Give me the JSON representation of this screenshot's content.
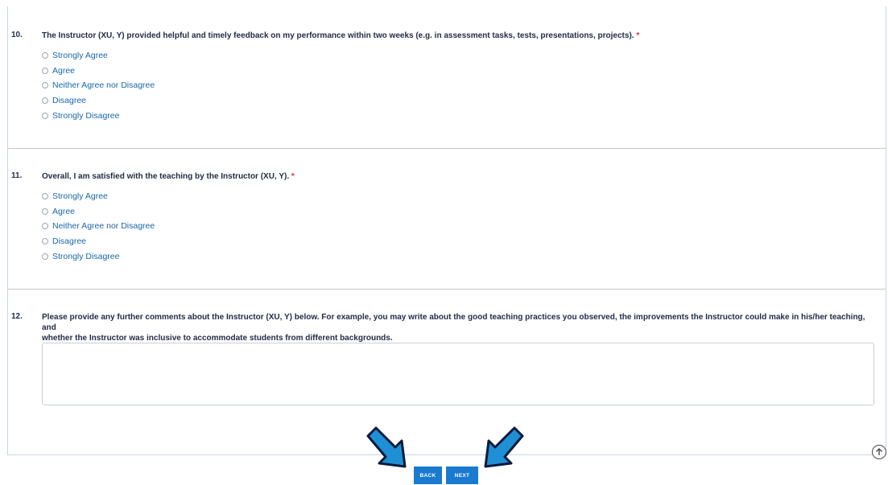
{
  "questions": [
    {
      "number": "10.",
      "text": "The Instructor (XU, Y) provided helpful and timely feedback on my performance within two weeks (e.g. in assessment tasks, tests, presentations, projects).",
      "required_mark": "*",
      "options": [
        "Strongly Agree",
        "Agree",
        "Neither Agree nor Disagree",
        "Disagree",
        "Strongly Disagree"
      ]
    },
    {
      "number": "11.",
      "text": "Overall, I am satisfied with the teaching by the Instructor (XU, Y).",
      "required_mark": "*",
      "options": [
        "Strongly Agree",
        "Agree",
        "Neither Agree nor Disagree",
        "Disagree",
        "Strongly Disagree"
      ]
    },
    {
      "number": "12.",
      "text_line1": "Please provide any further comments about the Instructor (XU, Y) below. For example, you may write about the good teaching practices you observed, the improvements the Instructor could make in his/her teaching, and",
      "text_line2": "whether the Instructor was inclusive to accommodate students from different backgrounds.",
      "comment_value": ""
    }
  ],
  "nav": {
    "back_label": "BACK",
    "next_label": "NEXT"
  },
  "colors": {
    "accent": "#1a7ad0",
    "option_text": "#1a67a8",
    "required": "#e03030",
    "arrow": "#1f8fd6"
  },
  "icons": {
    "scroll_top": "arrow-up-circle-icon",
    "pointer": "arrow-pointer-icon"
  }
}
